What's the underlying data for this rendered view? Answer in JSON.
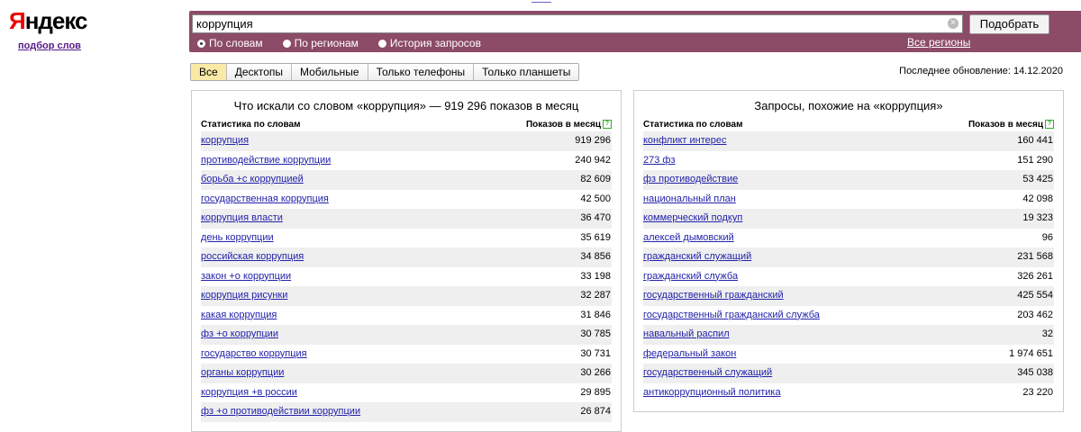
{
  "logo": {
    "first": "Я",
    "rest": "ндекс",
    "subtitle": "подбор слов"
  },
  "search": {
    "value": "коррупция",
    "button": "Подобрать",
    "clear": "×"
  },
  "radio_options": [
    {
      "label": "По словам",
      "selected": true
    },
    {
      "label": "По регионам",
      "selected": false
    },
    {
      "label": "История запросов",
      "selected": false
    }
  ],
  "all_regions": "Все регионы",
  "tabs": [
    "Все",
    "Десктопы",
    "Мобильные",
    "Только телефоны",
    "Только планшеты"
  ],
  "last_updated": "Последнее обновление: 14.12.2020",
  "left": {
    "title": "Что искали со словом «коррупция» — 919 296 показов в месяц",
    "col1": "Статистика по словам",
    "col2": "Показов в месяц",
    "rows": [
      [
        "коррупция",
        "919 296"
      ],
      [
        "противодействие коррупции",
        "240 942"
      ],
      [
        "борьба +с коррупцией",
        "82 609"
      ],
      [
        "государственная коррупция",
        "42 500"
      ],
      [
        "коррупция власти",
        "36 470"
      ],
      [
        "день коррупции",
        "35 619"
      ],
      [
        "российская коррупция",
        "34 856"
      ],
      [
        "закон +о коррупции",
        "33 198"
      ],
      [
        "коррупция рисунки",
        "32 287"
      ],
      [
        "какая коррупция",
        "31 846"
      ],
      [
        "фз +о коррупции",
        "30 785"
      ],
      [
        "государство коррупция",
        "30 731"
      ],
      [
        "органы коррупции",
        "30 266"
      ],
      [
        "коррупция +в россии",
        "29 895"
      ],
      [
        "фз +о противодействии коррупции",
        "26 874"
      ]
    ]
  },
  "right": {
    "title": "Запросы, похожие на «коррупция»",
    "col1": "Статистика по словам",
    "col2": "Показов в месяц",
    "rows": [
      [
        "конфликт интерес",
        "160 441"
      ],
      [
        "273 фз",
        "151 290"
      ],
      [
        "фз противодействие",
        "53 425"
      ],
      [
        "национальный план",
        "42 098"
      ],
      [
        "коммерческий подкуп",
        "19 323"
      ],
      [
        "алексей дымовский",
        "96"
      ],
      [
        "гражданский служащий",
        "231 568"
      ],
      [
        "гражданский служба",
        "326 261"
      ],
      [
        "государственный гражданский",
        "425 554"
      ],
      [
        "государственный гражданский служба",
        "203 462"
      ],
      [
        "навальный распил",
        "32"
      ],
      [
        "федеральный закон",
        "1 974 651"
      ],
      [
        "государственный служащий",
        "345 038"
      ],
      [
        "антикоррупционный политика",
        "23 220"
      ]
    ]
  }
}
